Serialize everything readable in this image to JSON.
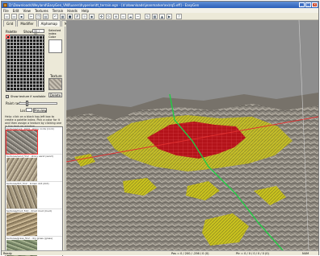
{
  "window": {
    "title": "D:\\Downloads\\Weyland\\EasyGen_VN0\\users\\hyperion\\tt_terrain.egn - [d:\\downloads\\jeanmarker\\ex\\rq5.eff] - EasyGen"
  },
  "menu": [
    "File",
    "Edit",
    "View",
    "Textures",
    "Terrain",
    "Hands",
    "Help"
  ],
  "toolbar": {
    "icons": [
      "new-icon",
      "open-icon",
      "save-icon",
      "cut-icon",
      "copy-icon",
      "paste-icon",
      "undo-icon",
      "wire-icon",
      "solid-icon",
      "grid-icon",
      "light-icon",
      "camera-icon",
      "move-icon",
      "rotate-icon",
      "zoom-icon",
      "fog-icon",
      "sky-icon",
      "water-icon",
      "brush-icon",
      "tex-icon",
      "height-icon",
      "render-icon",
      "help-icon"
    ]
  },
  "tabs": [
    "Grid",
    "Modifier",
    "Alphamap",
    "Models"
  ],
  "active_tab": "Alphamap",
  "panel": {
    "palette_label": "Palette",
    "show_label": "Show:",
    "show_value": "32 / 32",
    "selected_label": "Selected index Color",
    "texture_label": "Texture",
    "delete_label": "Delete",
    "show_texture_label": "Show texture if available",
    "show_texture_checked": "✓",
    "paint_label": "Paint radius:",
    "paint_level": 0.2,
    "lock_label": "Lock:",
    "preview_label": "Preview",
    "help_text": "Help: click on a black top-left box to create a palette index. Pick a color for it and then assign a texture by clicking one in the texture window."
  },
  "textures": [
    {
      "name": "textures/rock_1024 - stony rocks (rock)",
      "selected": true
    },
    {
      "name": "textures/sand_512 - stony sand (sand)",
      "selected": false
    },
    {
      "name": "textures/dirt_512 - brown dirt (dirt)",
      "selected": false
    },
    {
      "name": "textures/mud_512 - dried mud (mud)",
      "selected": false
    },
    {
      "name": "textures/grass_512 - dry grass (grass)",
      "selected": false
    }
  ],
  "status": {
    "left": "Ready",
    "position": "Pos = 0 / 200 / -256 / 0 (0)",
    "pointer": "Ptr = 0 / 0 / 0 / 0 / 0 (0)",
    "mode": "NUM"
  },
  "colors": {
    "sky": "#8e8e8e",
    "terrain": "#8a857c",
    "painted_red": "#b4131a",
    "painted_yellow": "#c9c21e",
    "axis_green": "#22cc44",
    "axis_red": "#e03030"
  }
}
